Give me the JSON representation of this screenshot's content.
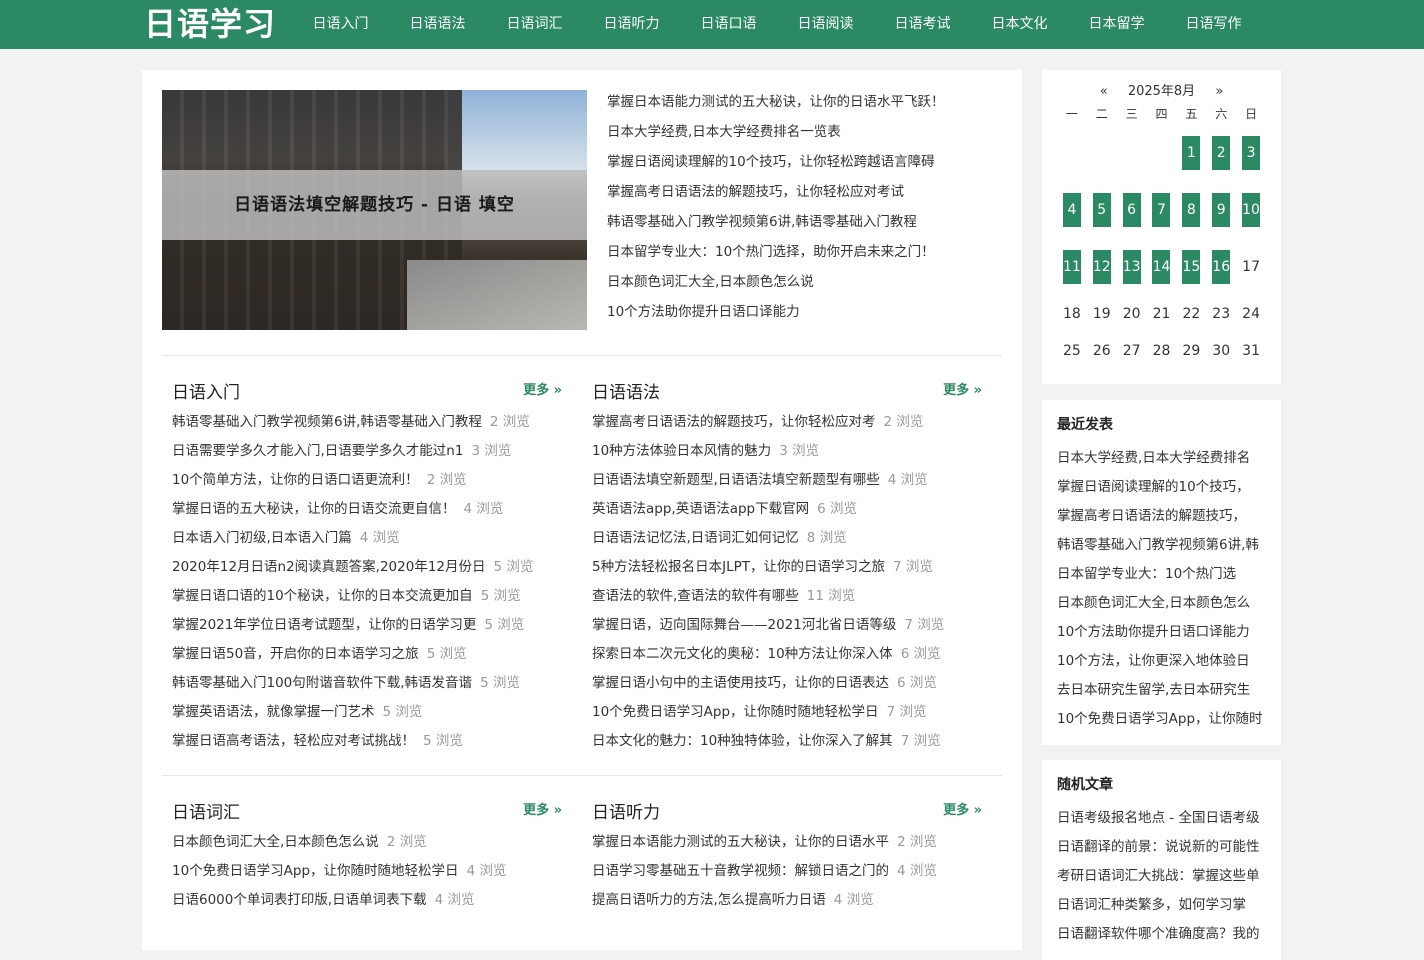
{
  "site": {
    "logo": "日语学习",
    "brand_color": "#2b8a63"
  },
  "nav": [
    "日语入门",
    "日语语法",
    "日语词汇",
    "日语听力",
    "日语口语",
    "日语阅读",
    "日语考试",
    "日本文化",
    "日本留学",
    "日语写作"
  ],
  "hero": {
    "caption": "日语语法填空解题技巧 - 日语 填空"
  },
  "headlines": [
    "掌握日本语能力测试的五大秘诀，让你的日语水平飞跃！",
    "日本大学经费,日本大学经费排名一览表",
    "掌握日语阅读理解的10个技巧，让你轻松跨越语言障碍",
    "掌握高考日语语法的解题技巧，让你轻松应对考试",
    "韩语零基础入门教学视频第6讲,韩语零基础入门教程",
    "日本留学专业大：10个热门选择，助你开启未来之门！",
    "日本颜色词汇大全,日本颜色怎么说",
    "10个方法助你提升日语口译能力"
  ],
  "views_suffix": "浏览",
  "sections": [
    {
      "title": "日语入门",
      "more": "更多 »",
      "items": [
        {
          "text": "韩语零基础入门教学视频第6讲,韩语零基础入门教程",
          "views": "2"
        },
        {
          "text": "日语需要学多久才能入门,日语要学多久才能过n1",
          "views": "3"
        },
        {
          "text": "10个简单方法，让你的日语口语更流利！",
          "views": "2"
        },
        {
          "text": "掌握日语的五大秘诀，让你的日语交流更自信！",
          "views": "4"
        },
        {
          "text": "日本语入门初级,日本语入门篇",
          "views": "4"
        },
        {
          "text": "2020年12月日语n2阅读真题答案,2020年12月份日",
          "views": "5"
        },
        {
          "text": "掌握日语口语的10个秘诀，让你的日本交流更加自",
          "views": "5"
        },
        {
          "text": "掌握2021年学位日语考试题型，让你的日语学习更",
          "views": "5"
        },
        {
          "text": "掌握日语50音，开启你的日本语学习之旅",
          "views": "5"
        },
        {
          "text": "韩语零基础入门100句附谐音软件下载,韩语发音谐",
          "views": "5"
        },
        {
          "text": "掌握英语语法，就像掌握一门艺术",
          "views": "5"
        },
        {
          "text": "掌握日语高考语法，轻松应对考试挑战！",
          "views": "5"
        }
      ]
    },
    {
      "title": "日语语法",
      "more": "更多 »",
      "items": [
        {
          "text": "掌握高考日语语法的解题技巧，让你轻松应对考",
          "views": "2"
        },
        {
          "text": "10种方法体验日本风情的魅力",
          "views": "3"
        },
        {
          "text": "日语语法填空新题型,日语语法填空新题型有哪些",
          "views": "4"
        },
        {
          "text": "英语语法app,英语语法app下载官网",
          "views": "6"
        },
        {
          "text": "日语语法记忆法,日语词汇如何记忆",
          "views": "8"
        },
        {
          "text": "5种方法轻松报名日本JLPT，让你的日语学习之旅",
          "views": "7"
        },
        {
          "text": "查语法的软件,查语法的软件有哪些",
          "views": "11"
        },
        {
          "text": "掌握日语，迈向国际舞台——2021河北省日语等级",
          "views": "7"
        },
        {
          "text": "探索日本二次元文化的奥秘：10种方法让你深入体",
          "views": "6"
        },
        {
          "text": "掌握日语小句中的主语使用技巧，让你的日语表达",
          "views": "6"
        },
        {
          "text": "10个免费日语学习App，让你随时随地轻松学日",
          "views": "7"
        },
        {
          "text": "日本文化的魅力：10种独特体验，让你深入了解其",
          "views": "7"
        }
      ]
    },
    {
      "title": "日语词汇",
      "more": "更多 »",
      "items": [
        {
          "text": "日本颜色词汇大全,日本颜色怎么说",
          "views": "2"
        },
        {
          "text": "10个免费日语学习App，让你随时随地轻松学日",
          "views": "4"
        },
        {
          "text": "日语6000个单词表打印版,日语单词表下载",
          "views": "4"
        }
      ]
    },
    {
      "title": "日语听力",
      "more": "更多 »",
      "items": [
        {
          "text": "掌握日本语能力测试的五大秘诀，让你的日语水平",
          "views": "2"
        },
        {
          "text": "日语学习零基础五十音教学视频：解锁日语之门的",
          "views": "4"
        },
        {
          "text": "提高日语听力的方法,怎么提高听力日语",
          "views": "4"
        }
      ]
    }
  ],
  "calendar": {
    "prev": "«",
    "month": "2025年8月",
    "next": "»",
    "weekdays": [
      "一",
      "二",
      "三",
      "四",
      "五",
      "六",
      "日"
    ],
    "rows": [
      [
        "",
        "",
        "",
        "",
        "1",
        "2",
        "3"
      ],
      [
        "4",
        "5",
        "6",
        "7",
        "8",
        "9",
        "10"
      ],
      [
        "11",
        "12",
        "13",
        "14",
        "15",
        "16",
        "17"
      ],
      [
        "18",
        "19",
        "20",
        "21",
        "22",
        "23",
        "24"
      ],
      [
        "25",
        "26",
        "27",
        "28",
        "29",
        "30",
        "31"
      ]
    ],
    "highlighted": [
      "1",
      "2",
      "3",
      "4",
      "5",
      "6",
      "7",
      "8",
      "9",
      "10",
      "11",
      "12",
      "13",
      "14",
      "15",
      "16"
    ]
  },
  "recent": {
    "title": "最近发表",
    "items": [
      "日本大学经费,日本大学经费排名",
      "掌握日语阅读理解的10个技巧，",
      "掌握高考日语语法的解题技巧，",
      "韩语零基础入门教学视频第6讲,韩",
      "日本留学专业大：10个热门选",
      "日本颜色词汇大全,日本颜色怎么",
      "10个方法助你提升日语口译能力",
      "10个方法，让你更深入地体验日",
      "去日本研究生留学,去日本研究生",
      "10个免费日语学习App，让你随时"
    ]
  },
  "random": {
    "title": "随机文章",
    "items": [
      "日语考级报名地点 - 全国日语考级",
      "日语翻译的前景：说说新的可能性",
      "考研日语词汇大挑战：掌握这些单",
      "日语词汇种类繁多，如何学习掌",
      "日语翻译软件哪个准确度高？我的"
    ]
  }
}
